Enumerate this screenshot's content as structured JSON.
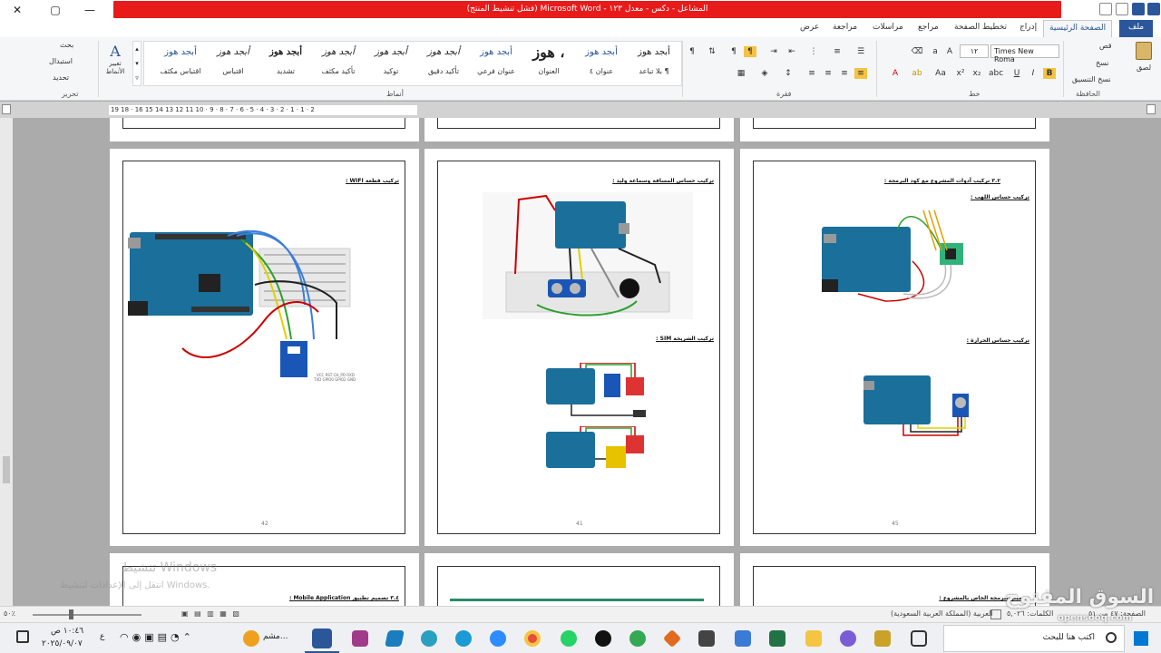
{
  "window": {
    "title": "المشاعل - دكس - معدل ١٢٣ - Microsoft Word (فشل تنشيط المنتج)",
    "controls": {
      "close": "✕",
      "maximize": "▢",
      "minimize": "—"
    }
  },
  "tabs": [
    "ملف",
    "الصفحة الرئيسية",
    "إدراج",
    "تخطيط الصفحة",
    "مراجع",
    "مراسلات",
    "مراجعة",
    "عرض"
  ],
  "ribbon": {
    "clipboard": {
      "paste": "لصق",
      "cut": "قص",
      "copy": "نسخ",
      "format_painter": "نسخ التنسيق",
      "label": "الحافظة"
    },
    "font": {
      "name": "Times New Roma",
      "size": "١٢",
      "label": "خط"
    },
    "paragraph": {
      "label": "فقرة"
    },
    "styles": {
      "label": "أنماط",
      "items": [
        {
          "preview": "أبجد هوز",
          "name": "¶ بلا تباعد"
        },
        {
          "preview": "أبجد هوز",
          "name": "عنوان ٤"
        },
        {
          "preview": "هوز ،",
          "name": "العنوان"
        },
        {
          "preview": "أبجد هوز",
          "name": "عنوان فرعي"
        },
        {
          "preview": "أبجد هوز",
          "name": "تأكيد دقيق"
        },
        {
          "preview": "أبجد هوز",
          "name": "توكيد"
        },
        {
          "preview": "أبجد هوز",
          "name": "تأكيد مكثف"
        },
        {
          "preview": "أبجد هوز",
          "name": "تشديد"
        },
        {
          "preview": "أبجد هوز",
          "name": "اقتباس"
        },
        {
          "preview": "أبجد هوز",
          "name": "اقتباس مكثف"
        }
      ],
      "change_styles": "تغيير الأنماط"
    },
    "editing": {
      "find": "بحث",
      "replace": "استبدال",
      "select": "تحديد",
      "label": "تحرير"
    }
  },
  "ruler": "19 18 · 16 15 14 13 12 11 10 · 9 · 8 · 7 · 6 · 5 · 4 · 3 · 2 · 1 · 1 · 2",
  "pages": {
    "p45": {
      "heading1": "٣.٢ تركيب أدوات المشروع مع كود البرمجة :",
      "heading2": "تركيب حساس اللهب :",
      "heading3": "تركيب حساس الحرارة :",
      "number": "45"
    },
    "p41": {
      "heading1": "تركيب حساس المسافة وسماعة وليد :",
      "heading2": "تركيب الشريحة SIM :",
      "number": "41"
    },
    "p42": {
      "heading1": "تركيب قطعة WIFI :",
      "esp_pins": "VCC RST CH_PD RXD",
      "esp_pins2": "TXD GPIO0 GPIO2 GND",
      "number": "42"
    },
    "p_bottom_left": {
      "heading": "٣.٤ تصميم تطبيق Mobile Application :"
    },
    "p_bottom_right": {
      "heading": "تصميم البرمجة الخاص بالمشروع :"
    }
  },
  "statusbar": {
    "page": "الصفحة: ٤٧ من ٥١",
    "words": "الكلمات: ٥,٠٢٦",
    "language": "العربية (المملكة العربية السعودية)",
    "zoom": "٥٠٪"
  },
  "activation": {
    "line1": "تنشيط Windows",
    "line2": "انتقل إلى الإعدادات لتنشيط Windows."
  },
  "taskbar": {
    "search": "اكتب هنا للبحث",
    "time": "١٠:٤٦ ص",
    "date": "٢٠٢٥/٠٩/٠٧",
    "lang": "ع",
    "app_label": "مشم..."
  },
  "brand": {
    "ar": "السوق المفتوح",
    "en": "opensooq.com"
  },
  "colors": {
    "title_red": "#e81b1b",
    "word_blue": "#2b579a",
    "arduino": "#1b6f9b"
  }
}
